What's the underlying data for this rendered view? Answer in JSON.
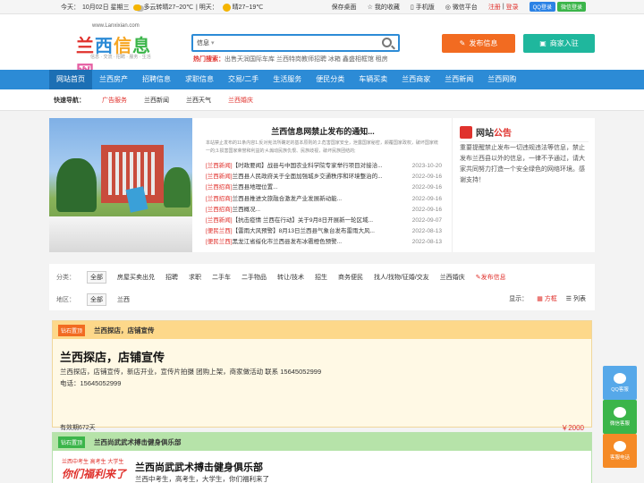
{
  "topbar": {
    "date_label": "今天：",
    "date": "10月02日 星期三",
    "today_weather": "多云转晴27~20℃",
    "tomorrow_label": "明天：",
    "tomorrow_weather": "晴27~19℃",
    "links": [
      "保存桌面",
      "我的收藏",
      "手机版",
      "微信平台"
    ],
    "register": "注册",
    "login": "登录",
    "qq_login": "QQ登录",
    "wx_login": "微信登录"
  },
  "logo": {
    "url": "www.Lanxixian.com",
    "chars": [
      "兰",
      "西",
      "信",
      "息",
      "网"
    ],
    "slogan": "信息 · 交流 · 招聘 · 服务 · 生活"
  },
  "search": {
    "category": "信息",
    "placeholder": "",
    "hot_label": "热门搜索：",
    "hot_terms": "出售天润国际车库  兰西特岗教师招聘  冰箱  鑫盛相框馆  租房"
  },
  "header_buttons": {
    "post": "发布信息",
    "shop": "商家入驻"
  },
  "nav": [
    "网站首页",
    "兰西房产",
    "招聘信息",
    "求职信息",
    "交易/二手",
    "生活服务",
    "便民分类",
    "车辆买卖",
    "兰西商家",
    "兰西新闻",
    "兰西网购"
  ],
  "quick": {
    "label": "快速导航：",
    "items": [
      "广告服务",
      "兰西新闻",
      "兰西天气",
      "兰西婚庆"
    ]
  },
  "notice": {
    "title": "兰西信息网禁止发布的通知...",
    "text": "本站禁止发布的11条内容1.反对宪法所确定的基本原则的;2.危害国家安全，泄露国家秘密，颠覆国家政权，破坏国家统一的;3.损害国家荣誉和利益的;4.煽动民族仇恨、民族歧视，破坏民族团结的;"
  },
  "news": [
    {
      "cat": "[兰西新闻]",
      "title": "【时政要闻】战县与中国农业科学院专家举行项目对接洽...",
      "date": "2023-10-20"
    },
    {
      "cat": "[兰西新闻]",
      "title": "兰西县人民政府关于全面加强城乡交通秩序和环境整治的...",
      "date": "2022-09-16"
    },
    {
      "cat": "[兰西招商]",
      "title": "兰西县地理位置...",
      "date": "2022-09-16"
    },
    {
      "cat": "[兰西招商]",
      "title": "兰西县推进文旅融合激发产业发展新动能...",
      "date": "2022-09-16"
    },
    {
      "cat": "[兰西招商]",
      "title": "兰西概况...",
      "date": "2022-09-16"
    },
    {
      "cat": "[兰西新闻]",
      "title": "【抗击疫情 兰西在行动】关于9月8日开展新一轮区域...",
      "date": "2022-09-07"
    },
    {
      "cat": "[便民兰西]",
      "title": "【雷雨大风预警】8月13日兰西县气象台发布雷雨大风...",
      "date": "2022-08-13"
    },
    {
      "cat": "[便民兰西]",
      "title": "黑龙江省绥化市兰西县发布冰雹橙色预警...",
      "date": "2022-08-13"
    }
  ],
  "announce": {
    "title_a": "网站",
    "title_b": "公告",
    "text": "重要提醒禁止发布一切违规违法等信息，禁止发布兰西县以外的信息，一律不予通过，请大家共同努力打造一个安全绿色的网络环境。感谢支持！"
  },
  "filter": {
    "cat_label": "分类：",
    "all": "全部",
    "cats": [
      "房屋买卖出兑",
      "招聘",
      "求职",
      "二手车",
      "二手物品",
      "转让/技术",
      "招生",
      "商务便民",
      "找人/找物/征婚/交友",
      "兰西婚庆"
    ],
    "post_info": "发布信息",
    "area_label": "地区：",
    "area": "兰西",
    "display_label": "显示：",
    "view_grid": "方框",
    "view_list": "列表"
  },
  "card1": {
    "tag": "钻石置顶",
    "title": "兰西探店，店铺宣传",
    "heading": "兰西探店，店铺宣传",
    "desc": "兰西探店，店铺宣传，新店开业，宣传片拍摄 团购上架，商家做活动 联系 15645052999",
    "tel": "电话：15645052999",
    "expiry": "有效期672天",
    "price": "￥2000"
  },
  "card2": {
    "tag": "钻石置顶",
    "title": "兰西尚武武术搏击健身俱乐部",
    "thumb_a": "兰西中考生 高考生 大学生",
    "thumb_b": "你们福利来了",
    "heading": "兰西尚武武术搏击健身俱乐部",
    "desc": "兰西中考生，高考生，大学生，你们福利来了"
  },
  "side": [
    "QQ客服",
    "微信客服",
    "客服电话"
  ]
}
